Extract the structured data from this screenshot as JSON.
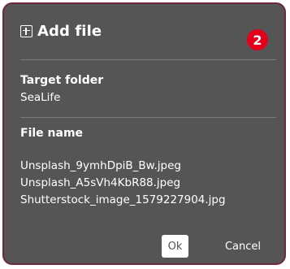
{
  "dialog": {
    "title": "Add file",
    "title_icon": "plus-square-icon",
    "badge": "2",
    "badge_color": "#e2001a",
    "border_color": "#6b2a3a",
    "background_color": "#555555"
  },
  "target_folder": {
    "label": "Target folder",
    "value": "SeaLife"
  },
  "file_name": {
    "label": "File name",
    "files": [
      "Unsplash_9ymhDpiB_Bw.jpeg",
      "Unsplash_A5sVh4KbR88.jpeg",
      "Shutterstock_image_1579227904.jpg"
    ]
  },
  "buttons": {
    "ok_label": "Ok",
    "cancel_label": "Cancel"
  }
}
